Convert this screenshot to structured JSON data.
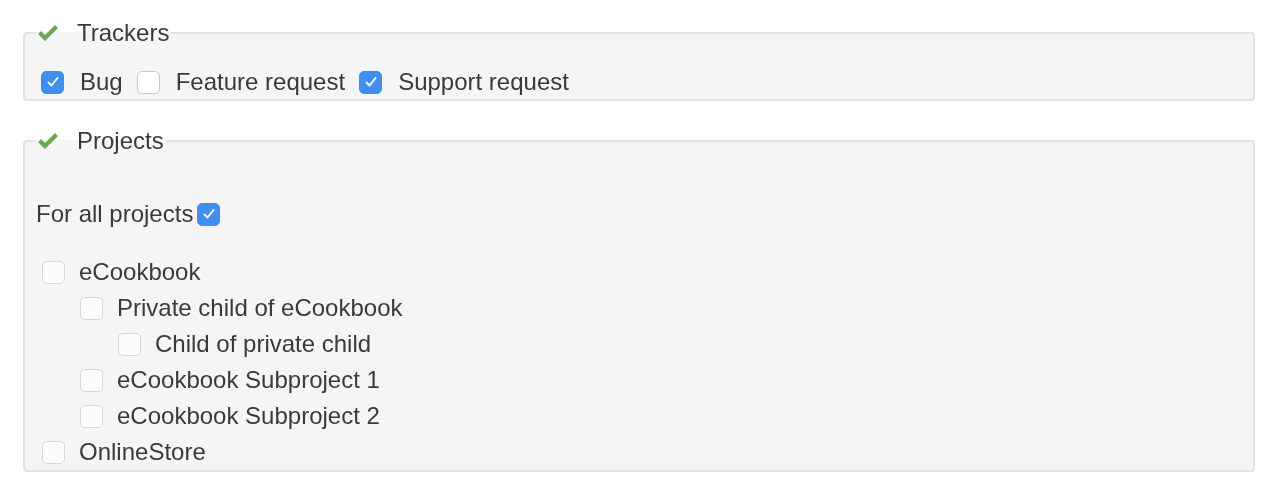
{
  "trackers": {
    "legend": "Trackers",
    "items": [
      {
        "label": "Bug",
        "checked": true
      },
      {
        "label": "Feature request",
        "checked": false
      },
      {
        "label": "Support request",
        "checked": true
      }
    ]
  },
  "projects": {
    "legend": "Projects",
    "all_projects": {
      "label": "For all projects",
      "checked": true
    },
    "tree": [
      {
        "label": "eCookbook",
        "checked": false,
        "disabled": true,
        "children": [
          {
            "label": "Private child of eCookbook",
            "checked": false,
            "disabled": true,
            "children": [
              {
                "label": "Child of private child",
                "checked": false,
                "disabled": true
              }
            ]
          },
          {
            "label": "eCookbook Subproject 1",
            "checked": false,
            "disabled": true
          },
          {
            "label": "eCookbook Subproject 2",
            "checked": false,
            "disabled": true
          }
        ]
      },
      {
        "label": "OnlineStore",
        "checked": false,
        "disabled": true
      }
    ]
  }
}
